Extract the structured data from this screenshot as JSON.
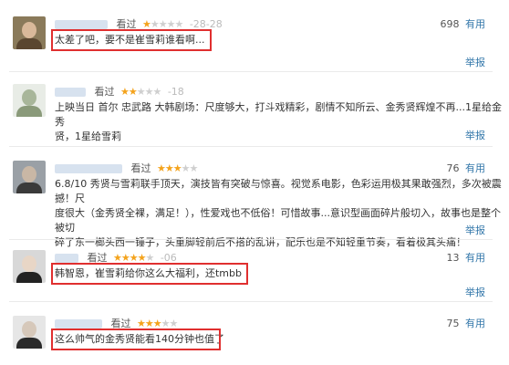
{
  "reviews": [
    {
      "watched": "看过",
      "stars": 1,
      "date": "-28-28",
      "votes": "698",
      "useful": "有用",
      "report": "举报",
      "lines": [
        "太差了吧，要不是崔雪莉谁看啊..."
      ]
    },
    {
      "watched": "看过",
      "stars": 2,
      "date": "-18",
      "votes": "",
      "useful": "有用",
      "report": "举报",
      "lines": [
        "上映当日 首尔 忠武路 大韩剧场：尺度够大，打斗戏精彩，剧情不知所云、金秀贤辉煌不再...1星给金秀",
        "贤，1星给雪莉"
      ]
    },
    {
      "watched": "看过",
      "stars": 3,
      "date": "",
      "votes": "76",
      "useful": "有用",
      "report": "举报",
      "lines": [
        "6.8/10 秀贤与雪莉联手顶天，演技皆有突破与惊喜。视觉系电影，色彩运用极其果敢强烈，多次被震撼！尺",
        "度很大（金秀贤全裸，满足！），性爱戏也不低俗！可惜故事...意识型画面碎片般切入，故事也是整个被切",
        "碎了东一榔头西一锤子，头重脚轻前后不搭的乱讲，配乐也是不知轻重节奏，看着极其头痛！"
      ]
    },
    {
      "watched": "看过",
      "stars": 4,
      "date": "-06",
      "votes": "13",
      "useful": "有用",
      "report": "举报",
      "lines": [
        "韩智恩，崔雪莉给你这么大福利，还tmbb"
      ]
    },
    {
      "watched": "看过",
      "stars": 3,
      "date": "",
      "votes": "75",
      "useful": "有用",
      "report": "",
      "lines": [
        "这么帅气的金秀贤能看140分钟也值了"
      ]
    }
  ]
}
